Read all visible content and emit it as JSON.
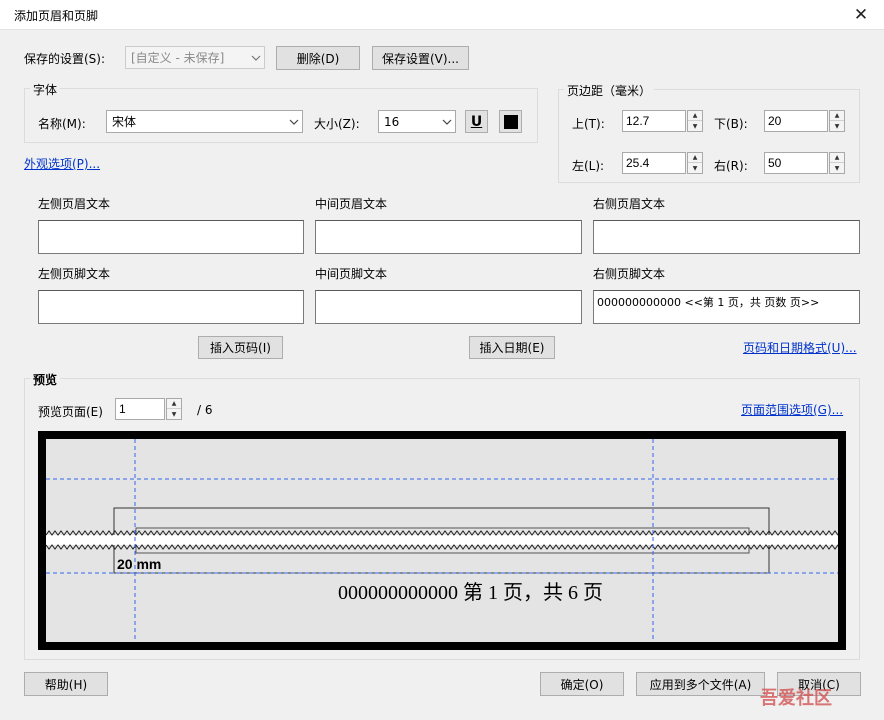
{
  "window": {
    "title": "添加页眉和页脚",
    "close": "✕"
  },
  "settings": {
    "label": "保存的设置(S):",
    "combo_value": "[自定义 - 未保存]",
    "delete_button": "删除(D)",
    "save_button": "保存设置(V)..."
  },
  "font": {
    "group_title": "字体",
    "name_label": "名称(M):",
    "name_value": "宋体",
    "size_label": "大小(Z):",
    "size_value": "16",
    "underline_glyph": "U",
    "color": "#000000"
  },
  "margins": {
    "group_title": "页边距（毫米）",
    "top_label": "上(T):",
    "top_value": "12.7",
    "bottom_label": "下(B):",
    "bottom_value": "20",
    "left_label": "左(L):",
    "left_value": "25.4",
    "right_label": "右(R):",
    "right_value": "50"
  },
  "appearance_link": "外观选项(P)...",
  "header_footer": {
    "left_header_label": "左侧页眉文本",
    "center_header_label": "中间页眉文本",
    "right_header_label": "右侧页眉文本",
    "left_footer_label": "左侧页脚文本",
    "center_footer_label": "中间页脚文本",
    "right_footer_label": "右侧页脚文本",
    "left_header_value": "",
    "center_header_value": "",
    "right_header_value": "",
    "left_footer_value": "",
    "center_footer_value": "",
    "right_footer_value": "000000000000 <<第 1 页，共 页数 页>>"
  },
  "insert_page_button": "插入页码(I)",
  "insert_date_button": "插入日期(E)",
  "format_link": "页码和日期格式(U)...",
  "preview": {
    "group_title": "预览",
    "page_label": "预览页面(E)",
    "page_value": "1",
    "page_total": "/ 6",
    "range_link": "页面范围选项(G)...",
    "margin_readout": "20 mm",
    "footer_text": "000000000000 第 1 页，共 6 页"
  },
  "footer_buttons": {
    "help": "帮助(H)",
    "ok": "确定(O)",
    "apply_multiple": "应用到多个文件(A)",
    "cancel": "取消(C)"
  },
  "watermark": "吾爱社区"
}
